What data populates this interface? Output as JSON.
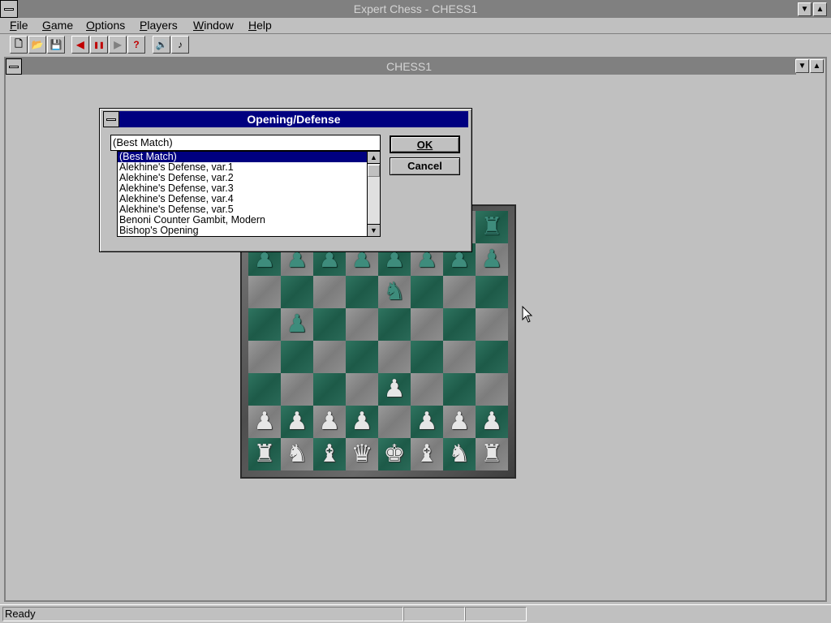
{
  "app": {
    "title": "Expert Chess - CHESS1"
  },
  "menu": [
    {
      "label": "File",
      "ul": "F",
      "rest": "ile"
    },
    {
      "label": "Game",
      "ul": "G",
      "rest": "ame"
    },
    {
      "label": "Options",
      "ul": "O",
      "rest": "ptions"
    },
    {
      "label": "Players",
      "ul": "P",
      "rest": "layers"
    },
    {
      "label": "Window",
      "ul": "W",
      "rest": "indow"
    },
    {
      "label": "Help",
      "ul": "H",
      "rest": "elp"
    }
  ],
  "toolbar": {
    "buttons": [
      {
        "name": "new-file-icon",
        "glyph": "🗋"
      },
      {
        "name": "open-folder-icon",
        "glyph": "📂"
      },
      {
        "name": "save-disk-icon",
        "glyph": "💾"
      },
      {
        "name": "step-back-icon",
        "glyph": "◀"
      },
      {
        "name": "pause-icon",
        "glyph": "❚❚"
      },
      {
        "name": "step-forward-icon",
        "glyph": "▶"
      },
      {
        "name": "help-question-icon",
        "glyph": "?"
      },
      {
        "name": "sound-icon",
        "glyph": "🔊"
      },
      {
        "name": "music-note-icon",
        "glyph": "♪"
      }
    ]
  },
  "child_window": {
    "title": "CHESS1"
  },
  "dialog": {
    "title": "Opening/Defense",
    "combo_value": "(Best Match)",
    "list_items": [
      "(Best Match)",
      "Alekhine's Defense, var.1",
      "Alekhine's Defense, var.2",
      "Alekhine's Defense, var.3",
      "Alekhine's Defense, var.4",
      "Alekhine's Defense, var.5",
      "Benoni Counter Gambit, Modern",
      "Bishop's Opening"
    ],
    "selected_index": 0,
    "ok_label": "OK",
    "cancel_label": "Cancel"
  },
  "board": {
    "ranks": [
      "rnbqkbnr",
      "pppppppp",
      "....n...",
      ".p......",
      "........",
      "....P...",
      "PPPP.PPP",
      "RNBQKBNR"
    ],
    "colors": {
      "light": "#8c8c8c",
      "dark": "#1f5e4b"
    }
  },
  "status": {
    "text": "Ready"
  }
}
